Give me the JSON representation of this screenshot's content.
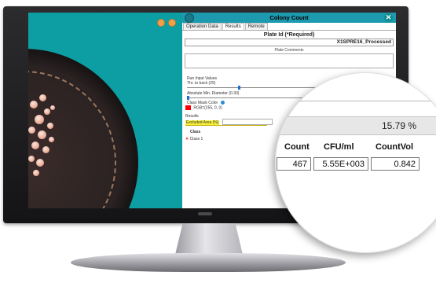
{
  "window": {
    "title": "Colony Count",
    "close_glyph": "✕"
  },
  "tabs": [
    "Operation Data",
    "Results",
    "Remote"
  ],
  "plate": {
    "label": "Plate Id (*Required)",
    "value": "X1SPRE16_Processed",
    "comments_label": "Plate Comments"
  },
  "run_inputs": {
    "heading": "Run Input Values",
    "threshold_label": "Thr. to back (25)",
    "threshold_value": 25,
    "threshold_range": [
      0,
      100
    ],
    "min_diameter_label": "Absolute Min. Diameter (0.30)",
    "min_diameter_value": 0.3,
    "mask_color_label": "Class Mask Color",
    "mask_color_value": "RGB=(255, 0, 0)",
    "mask_color": "#ff0000"
  },
  "results": {
    "heading": "Results",
    "excluded_area_label": "Excluded Area (%)",
    "excluded_area_value": "15.79 %",
    "class_heading": "Class",
    "class_item": "Class 1",
    "columns": [
      "Count",
      "CFU/ml",
      "CountVol"
    ],
    "values": [
      "467",
      "5.55E+003",
      "0.842"
    ]
  },
  "colors": {
    "screen_bg": "#0d9ea3",
    "titlebar": "#1e9ab0",
    "highlight": "#f6f23a"
  },
  "icons": [
    "app-logo-icon",
    "close-icon",
    "help-icon",
    "class-marker-icon",
    "toolbar-icon"
  ]
}
